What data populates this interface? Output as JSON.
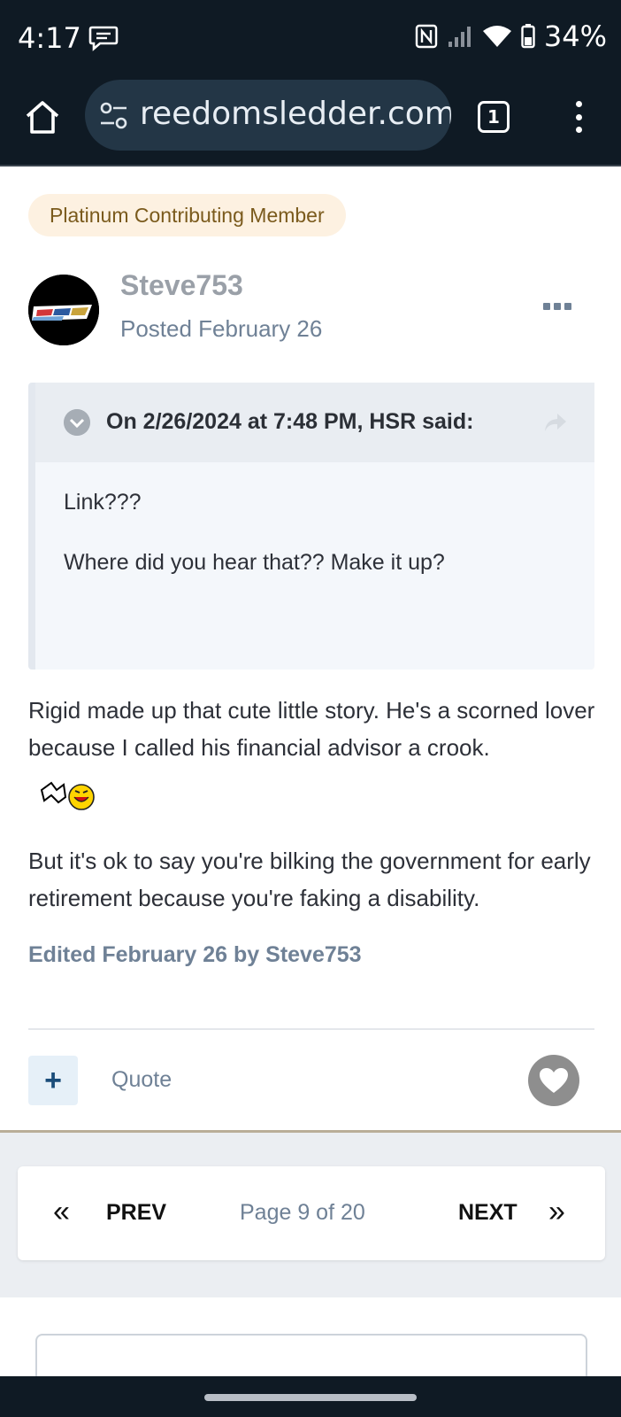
{
  "status_bar": {
    "time": "4:17",
    "battery": "34%",
    "icons": [
      "message-icon",
      "nfc-icon",
      "signal-icon",
      "wifi-icon",
      "battery-icon"
    ]
  },
  "browser": {
    "url": "reedomsledder.com",
    "tab_count": "1",
    "colors": {
      "toolbar_bg": "#0f1a24",
      "url_pill_bg": "#233646"
    }
  },
  "post": {
    "member_badge": "Platinum Contributing Member",
    "author": "Steve753",
    "posted": "Posted February 26",
    "quote": {
      "attribution": "On 2/26/2024 at 7:48 PM, HSR said:",
      "lines": [
        "Link???",
        "Where did you hear that?? Make it up?"
      ]
    },
    "body_paragraphs": [
      "Rigid made up that cute little story. He's a scorned lover because I called his financial advisor a crook.",
      "But it's ok to say you're bilking the government for early retirement because you're faking a disability."
    ],
    "edited_note": "Edited February 26 by Steve753",
    "actions": {
      "plus_label": "+",
      "quote_label": "Quote"
    }
  },
  "pagination": {
    "prev_arrow": "«",
    "prev_label": "PREV",
    "page_text": "Page 9 of 20",
    "next_label": "NEXT",
    "next_arrow": "»"
  }
}
